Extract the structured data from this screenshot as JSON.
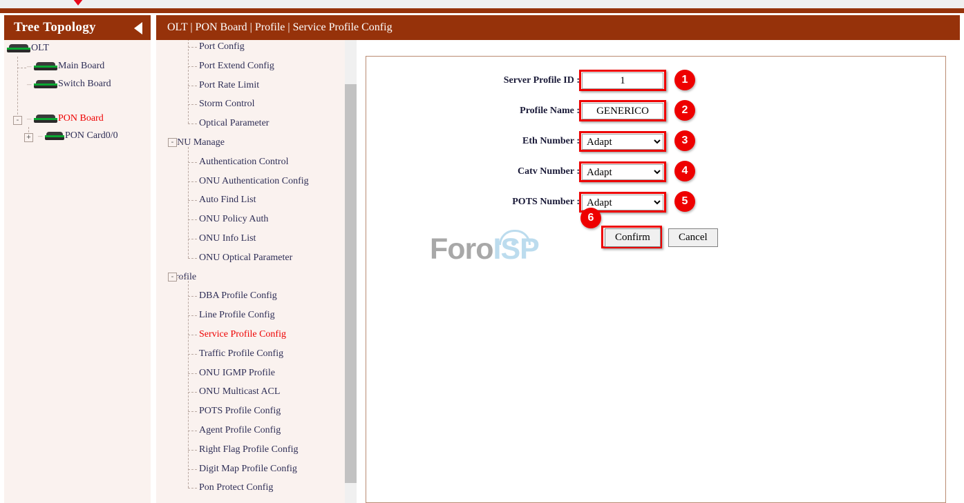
{
  "header": {
    "breadcrumb": "OLT | PON Board | Profile | Service Profile Config",
    "tree_title": "Tree Topology",
    "collapse_icon": "left-triangle-icon"
  },
  "tree": {
    "nodes": [
      {
        "label": "OLT",
        "level": 0,
        "icon": "device-icon",
        "red": false,
        "expander": ""
      },
      {
        "label": "Main Board",
        "level": 1,
        "icon": "device-icon",
        "red": false,
        "expander": ""
      },
      {
        "label": "Switch Board",
        "level": 1,
        "icon": "device-icon",
        "red": false,
        "expander": ""
      },
      {
        "label": "PON Board",
        "level": 1,
        "icon": "device-icon",
        "red": true,
        "expander": "-"
      },
      {
        "label": "PON Card0/0",
        "level": 2,
        "icon": "device-icon",
        "red": false,
        "expander": "+"
      }
    ]
  },
  "menu": {
    "items": [
      {
        "label": "Port Config",
        "type": "leaf",
        "active": false,
        "partial": true
      },
      {
        "label": "Port Extend Config",
        "type": "leaf",
        "active": false
      },
      {
        "label": "Port Rate Limit",
        "type": "leaf",
        "active": false
      },
      {
        "label": "Storm Control",
        "type": "leaf",
        "active": false
      },
      {
        "label": "Optical Parameter",
        "type": "leaf",
        "active": false,
        "last": true
      },
      {
        "label": "ONU Manage",
        "type": "group",
        "expander": "-"
      },
      {
        "label": "Authentication Control",
        "type": "leaf",
        "active": false
      },
      {
        "label": "ONU Authentication Config",
        "type": "leaf",
        "active": false
      },
      {
        "label": "Auto Find List",
        "type": "leaf",
        "active": false
      },
      {
        "label": "ONU Policy Auth",
        "type": "leaf",
        "active": false
      },
      {
        "label": "ONU Info List",
        "type": "leaf",
        "active": false
      },
      {
        "label": "ONU Optical Parameter",
        "type": "leaf",
        "active": false,
        "last": true
      },
      {
        "label": "Profile",
        "type": "group",
        "expander": "-"
      },
      {
        "label": "DBA Profile Config",
        "type": "leaf",
        "active": false
      },
      {
        "label": "Line Profile Config",
        "type": "leaf",
        "active": false
      },
      {
        "label": "Service Profile Config",
        "type": "leaf",
        "active": true
      },
      {
        "label": "Traffic Profile Config",
        "type": "leaf",
        "active": false
      },
      {
        "label": "ONU IGMP Profile",
        "type": "leaf",
        "active": false
      },
      {
        "label": "ONU Multicast ACL",
        "type": "leaf",
        "active": false
      },
      {
        "label": "POTS Profile Config",
        "type": "leaf",
        "active": false
      },
      {
        "label": "Agent Profile Config",
        "type": "leaf",
        "active": false
      },
      {
        "label": "Right Flag Profile Config",
        "type": "leaf",
        "active": false
      },
      {
        "label": "Digit Map Profile Config",
        "type": "leaf",
        "active": false
      },
      {
        "label": "Pon Protect Config",
        "type": "leaf",
        "active": false,
        "last": true
      }
    ]
  },
  "form": {
    "fields": [
      {
        "label": "Server Profile ID :",
        "kind": "text",
        "value": "1",
        "badge": "1"
      },
      {
        "label": "Profile Name :",
        "kind": "text",
        "value": "GENERICO",
        "badge": "2"
      },
      {
        "label": "Eth Number :",
        "kind": "select",
        "value": "Adapt",
        "badge": "3",
        "options": [
          "Adapt"
        ]
      },
      {
        "label": "Catv Number :",
        "kind": "select",
        "value": "Adapt",
        "badge": "4",
        "options": [
          "Adapt"
        ]
      },
      {
        "label": "POTS Number :",
        "kind": "select",
        "value": "Adapt",
        "badge": "5",
        "options": [
          "Adapt"
        ]
      }
    ],
    "confirm_label": "Confirm",
    "cancel_label": "Cancel",
    "confirm_badge": "6"
  },
  "watermark": {
    "part1": "Foro",
    "part2": "ISP"
  },
  "colors": {
    "brand_brown": "#96320a",
    "panel_bg": "#faf2ef",
    "accent_red": "#ee0000",
    "link_navy": "#2e2e56",
    "panel_border": "#b98a70"
  }
}
